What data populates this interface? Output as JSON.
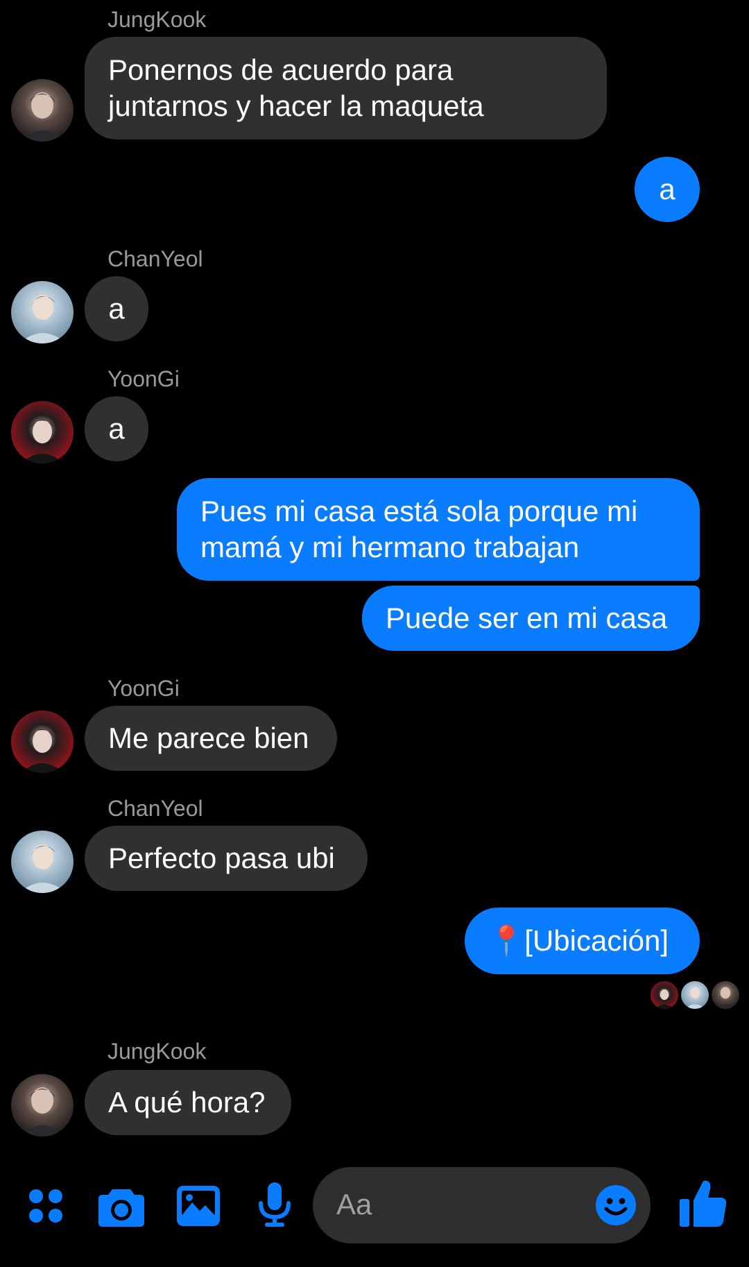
{
  "conversation": {
    "messages": [
      {
        "sender": "JungKook",
        "text_lines": [
          "Ponernos de acuerdo para",
          "juntarnos y hacer la maqueta"
        ]
      },
      {
        "sender": "me",
        "text": "a"
      },
      {
        "sender": "ChanYeol",
        "text": "a"
      },
      {
        "sender": "YoonGi",
        "text": "a"
      },
      {
        "sender": "me",
        "text_lines": [
          "Pues mi casa está sola porque mi",
          "mamá y mi hermano trabajan"
        ]
      },
      {
        "sender": "me",
        "text": "Puede ser en mi casa"
      },
      {
        "sender": "YoonGi",
        "text": "Me parece bien"
      },
      {
        "sender": "ChanYeol",
        "text": "Perfecto pasa ubi"
      },
      {
        "sender": "me",
        "text": "📍[Ubicación]"
      },
      {
        "sender": "JungKook",
        "text": "A qué hora?"
      }
    ]
  },
  "composer": {
    "placeholder": "Aa",
    "icons": [
      "apps-icon",
      "camera-icon",
      "gallery-icon",
      "microphone-icon",
      "emoji-icon",
      "like-icon"
    ]
  },
  "read_receipts": [
    "YoonGi",
    "ChanYeol",
    "JungKook"
  ],
  "colors": {
    "background": "#000000",
    "incoming_bubble": "#303030",
    "outgoing_bubble": "#0a7cff",
    "accent": "#0a7cff",
    "sender_name": "#9a9a9a"
  }
}
